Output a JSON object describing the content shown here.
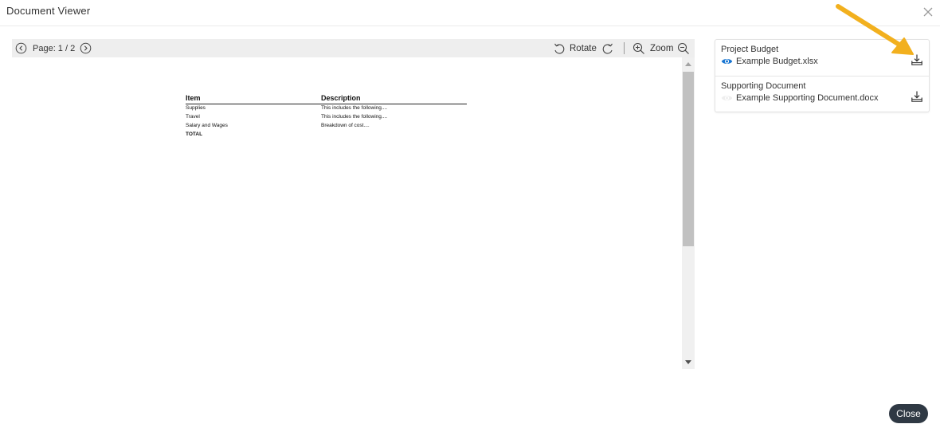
{
  "window": {
    "title": "Document Viewer"
  },
  "toolbar": {
    "page_label": "Page: 1 / 2",
    "rotate_label": "Rotate",
    "zoom_label": "Zoom"
  },
  "document": {
    "columns": [
      "Item",
      "Description"
    ],
    "rows": [
      [
        "Supplies",
        "This includes the following...."
      ],
      [
        "Travel",
        "This includes the following...."
      ],
      [
        "Salary and Wages",
        "Breakdown of cost...."
      ],
      [
        "TOTAL",
        ""
      ]
    ]
  },
  "files": [
    {
      "title": "Project Budget",
      "filename": "Example Budget.xlsx",
      "active": true
    },
    {
      "title": "Supporting Document",
      "filename": "Example Supporting Document.docx",
      "active": false
    }
  ],
  "footer": {
    "close_label": "Close"
  },
  "colors": {
    "accent": "#1976d2",
    "close_button": "#2f3944",
    "annotation_arrow": "#f2b01e"
  },
  "icons": {
    "prev": "chevron-left-circle-icon",
    "next": "chevron-right-circle-icon",
    "rotate_left": "rotate-left-icon",
    "rotate_right": "rotate-right-icon",
    "zoom_in": "zoom-in-icon",
    "zoom_out": "zoom-out-icon",
    "view": "eye-icon",
    "download": "download-icon",
    "close": "close-icon"
  }
}
